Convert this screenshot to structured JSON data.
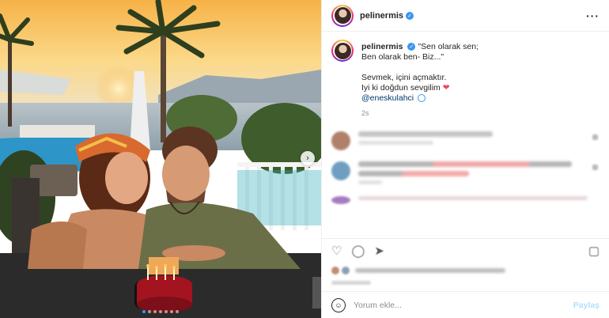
{
  "post": {
    "username": "pelinermis",
    "more_icon": "more-horizontal-icon",
    "caption": {
      "username": "pelinermis",
      "line1": "\"Sen olarak sen;",
      "line2": "Ben olarak ben- Biz...\"",
      "line3": "Sevmek, içini açmaktır.",
      "line4": "Iyi ki doğdun sevgilim",
      "mention": "@eneskulahci",
      "age": "2s"
    }
  },
  "add_comment": {
    "placeholder": "Yorum ekle...",
    "post_label": "Paylaş"
  },
  "colors": {
    "verified": "#3897f0",
    "link": "#00376b",
    "heart": "#ed4956",
    "post_disabled": "#b2dffc"
  }
}
